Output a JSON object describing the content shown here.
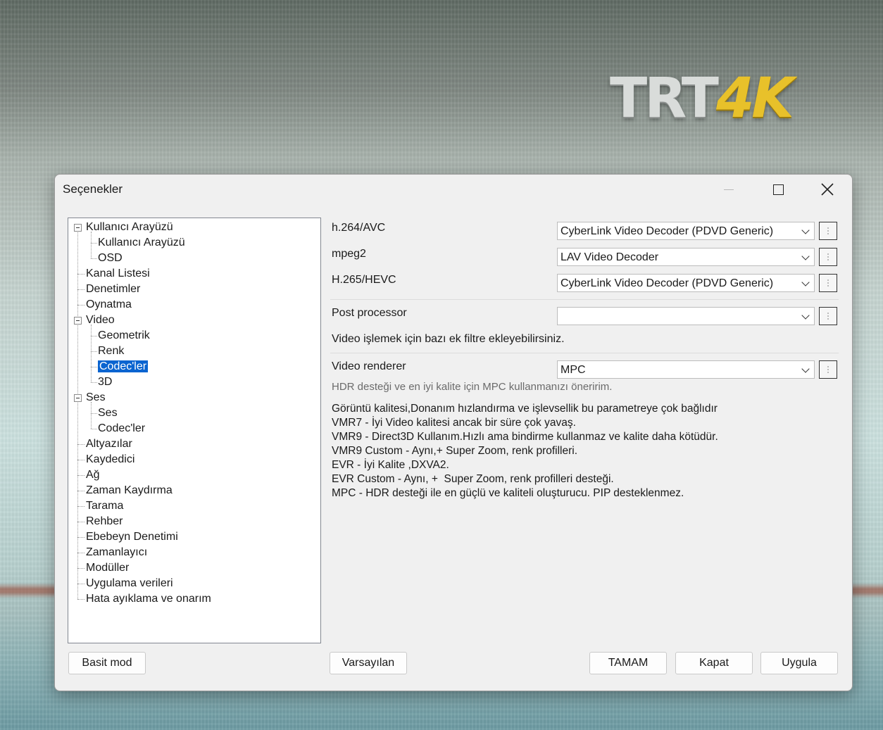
{
  "background": {
    "logo_text_1": "TRT",
    "logo_text_2": "4K"
  },
  "window": {
    "title": "Seçenekler"
  },
  "tree": [
    {
      "label": "Kullanıcı Arayüzü",
      "level": 0,
      "expandable": true
    },
    {
      "label": "Kullanıcı Arayüzü",
      "level": 1
    },
    {
      "label": "OSD",
      "level": 1
    },
    {
      "label": "Kanal Listesi",
      "level": 0
    },
    {
      "label": "Denetimler",
      "level": 0
    },
    {
      "label": "Oynatma",
      "level": 0
    },
    {
      "label": "Video",
      "level": 0,
      "expandable": true
    },
    {
      "label": "Geometrik",
      "level": 1
    },
    {
      "label": "Renk",
      "level": 1
    },
    {
      "label": "Codec'ler",
      "level": 1,
      "selected": true
    },
    {
      "label": "3D",
      "level": 1
    },
    {
      "label": "Ses",
      "level": 0,
      "expandable": true
    },
    {
      "label": "Ses",
      "level": 1
    },
    {
      "label": "Codec'ler",
      "level": 1
    },
    {
      "label": "Altyazılar",
      "level": 0
    },
    {
      "label": "Kaydedici",
      "level": 0
    },
    {
      "label": "Ağ",
      "level": 0
    },
    {
      "label": "Zaman Kaydırma",
      "level": 0
    },
    {
      "label": "Tarama",
      "level": 0
    },
    {
      "label": "Rehber",
      "level": 0
    },
    {
      "label": "Ebebeyn Denetimi",
      "level": 0
    },
    {
      "label": "Zamanlayıcı",
      "level": 0
    },
    {
      "label": "Modüller",
      "level": 0
    },
    {
      "label": "Uygulama verileri",
      "level": 0
    },
    {
      "label": "Hata ayıklama ve onarım",
      "level": 0
    }
  ],
  "codecs": {
    "h264_label": "h.264/AVC",
    "h264_value": "CyberLink Video Decoder (PDVD Generic)",
    "mpeg2_label": "mpeg2",
    "mpeg2_value": "LAV Video Decoder",
    "hevc_label": "H.265/HEVC",
    "hevc_value": "CyberLink Video Decoder (PDVD Generic)",
    "post_label": "Post processor",
    "post_value": "",
    "post_hint": "Video işlemek için bazı ek filtre ekleyebilirsiniz.",
    "renderer_label": "Video renderer",
    "renderer_value": "MPC",
    "renderer_hint": "HDR desteği ve en iyi kalite için MPC kullanmanızı öneririm.",
    "description": [
      "Görüntü kalitesi,Donanım hızlandırma ve işlevsellik bu parametreye çok bağlıdır",
      "VMR7 - İyi Video kalitesi ancak bir süre çok yavaş.",
      "VMR9 - Direct3D Kullanım.Hızlı ama bindirme kullanmaz ve kalite daha kötüdür.",
      "VMR9 Custom - Aynı,+ Super Zoom, renk profilleri.",
      "EVR - İyi Kalite ,DXVA2.",
      "EVR Custom - Aynı, +  Super Zoom, renk profilleri desteği.",
      "MPC - HDR desteği ile en güçlü ve kaliteli oluşturucu. PIP desteklenmez."
    ]
  },
  "buttons": {
    "basic_mode": "Basit mod",
    "defaults": "Varsayılan",
    "ok": "TAMAM",
    "close": "Kapat",
    "apply": "Uygula"
  }
}
